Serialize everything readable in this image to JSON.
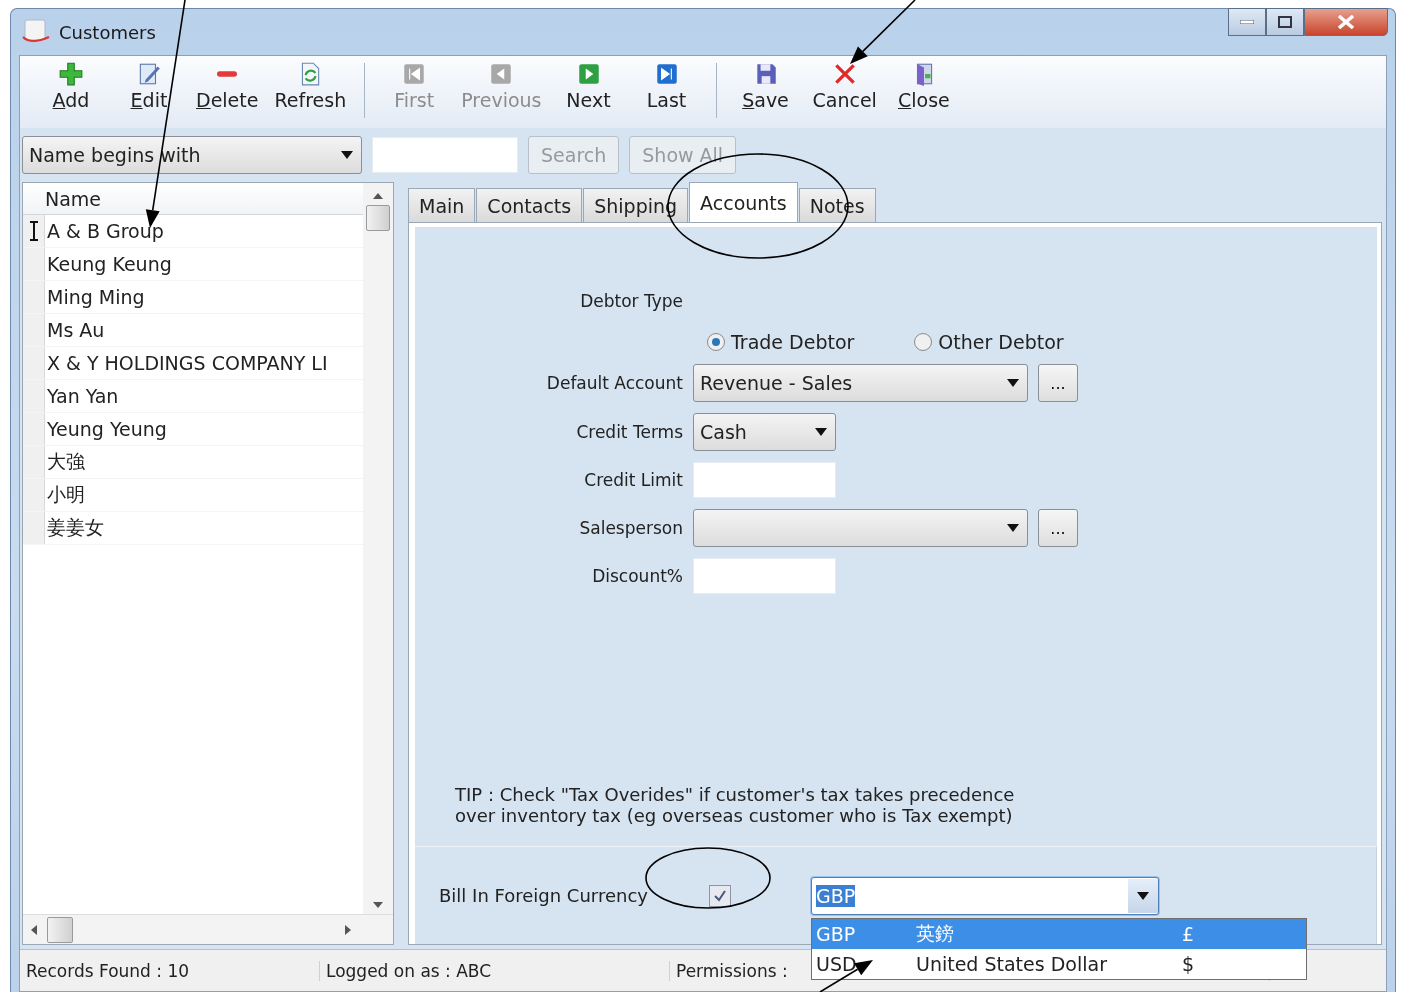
{
  "window": {
    "title": "Customers"
  },
  "toolbar": [
    [
      {
        "kind": "add",
        "label": "Add",
        "underline_first": true,
        "disabled": false
      },
      {
        "kind": "edit",
        "label": "Edit",
        "underline_first": true,
        "disabled": false
      },
      {
        "kind": "delete",
        "label": "Delete",
        "underline_first": true,
        "disabled": false
      },
      {
        "kind": "refresh",
        "label": "Refresh",
        "underline_first": false,
        "disabled": false
      }
    ],
    [
      {
        "kind": "first",
        "label": "First",
        "underline_first": false,
        "disabled": true
      },
      {
        "kind": "previous",
        "label": "Previous",
        "underline_first": false,
        "disabled": true
      },
      {
        "kind": "next",
        "label": "Next",
        "underline_first": false,
        "disabled": false
      },
      {
        "kind": "last",
        "label": "Last",
        "underline_first": false,
        "disabled": false
      }
    ],
    [
      {
        "kind": "save",
        "label": "Save",
        "underline_first": true,
        "disabled": false
      },
      {
        "kind": "cancel",
        "label": "Cancel",
        "underline_first": false,
        "disabled": false
      },
      {
        "kind": "close",
        "label": "Close",
        "underline_first": true,
        "disabled": false
      }
    ]
  ],
  "filter": {
    "mode": "Name begins with",
    "buttons": [
      {
        "label": "Search",
        "disabled": true
      },
      {
        "label": "Show All",
        "disabled": true
      }
    ]
  },
  "grid": {
    "column": "Name",
    "rows": [
      {
        "name": "A & B Group",
        "current": true
      },
      {
        "name": "Keung Keung",
        "current": false
      },
      {
        "name": "Ming Ming",
        "current": false
      },
      {
        "name": "Ms Au",
        "current": false
      },
      {
        "name": "X & Y HOLDINGS COMPANY LI",
        "current": false
      },
      {
        "name": "Yan Yan",
        "current": false
      },
      {
        "name": "Yeung Yeung",
        "current": false
      },
      {
        "name": "大強",
        "current": false
      },
      {
        "name": "小明",
        "current": false
      },
      {
        "name": "姜姜女",
        "current": false
      }
    ]
  },
  "tabs": [
    {
      "label": "Main",
      "selected": false
    },
    {
      "label": "Contacts",
      "selected": false
    },
    {
      "label": "Shipping",
      "selected": false
    },
    {
      "label": "Accounts",
      "selected": true
    },
    {
      "label": "Notes",
      "selected": false
    }
  ],
  "accounts": {
    "debtor_type": {
      "label": "Debtor Type",
      "options": [
        {
          "label": "Trade Debtor",
          "selected": true
        },
        {
          "label": "Other Debtor",
          "selected": false
        }
      ]
    },
    "fields": [
      {
        "kind": "combo",
        "label": "Default Account",
        "value": "Revenue - Sales",
        "wide": true,
        "browse": "..."
      },
      {
        "kind": "combo",
        "label": "Credit Terms",
        "value": "Cash",
        "wide": false
      },
      {
        "kind": "text",
        "label": "Credit Limit"
      },
      {
        "kind": "combo",
        "label": "Salesperson",
        "wide": true,
        "browse": "..."
      },
      {
        "kind": "text",
        "label": "Discount%"
      }
    ],
    "tip": [
      "TIP : Check \"Tax Overides\" if customer's tax takes precedence",
      "over inventory tax (eg overseas customer who is Tax exempt)"
    ]
  },
  "foreign_currency": {
    "label": "Bill In Foreign Currency",
    "checked": true,
    "currency": "GBP",
    "expanded": true,
    "options": [
      {
        "code": "GBP",
        "name": "英鎊",
        "symbol": "£",
        "selected": true
      },
      {
        "code": "USD",
        "name": "United States Dollar",
        "symbol": "$",
        "selected": false
      }
    ]
  },
  "status_bar": [
    "Records Found : 10",
    "Logged on as : ABC",
    "Permissions :"
  ]
}
